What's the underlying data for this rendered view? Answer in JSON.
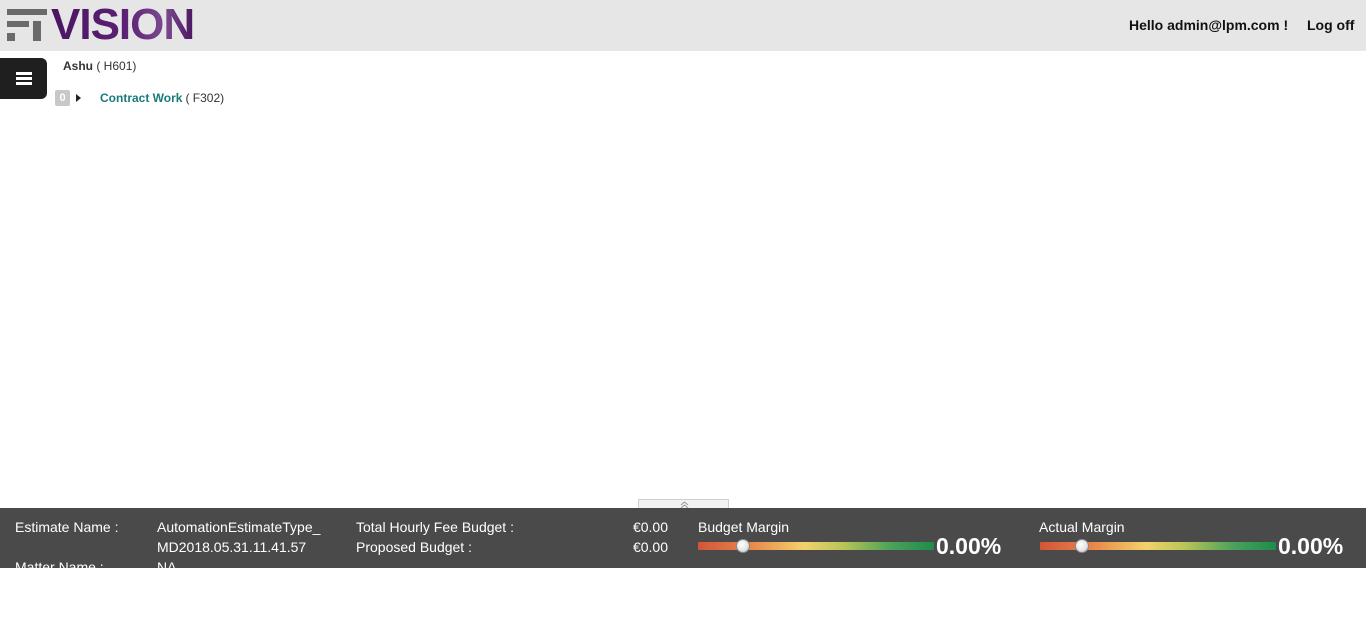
{
  "header": {
    "logo_text": "VISION",
    "greeting": "Hello admin@lpm.com !",
    "logoff_label": "Log off"
  },
  "menu": {
    "icon": "hamburger-icon"
  },
  "tree": {
    "root_name": "Ashu",
    "root_code": "( H601)",
    "items": [
      {
        "badge": "0",
        "icon": "caret-right-icon",
        "label": "Contract Work",
        "code": "( F302)"
      }
    ]
  },
  "collapse_handle": {
    "icon": "double-chevron-up-icon"
  },
  "footer": {
    "estimate_name_label": "Estimate Name :",
    "estimate_name_line1": "AutomationEstimateType_",
    "estimate_name_line2": "MD2018.05.31.11.41.57",
    "matter_name_label": "Matter Name :",
    "matter_name_value": "NA",
    "total_hourly_label": "Total Hourly Fee Budget :",
    "total_hourly_value": "€0.00",
    "proposed_budget_label": "Proposed Budget :",
    "proposed_budget_value": "€0.00",
    "budget_margin": {
      "title": "Budget Margin",
      "value": "0.00%",
      "level": 0.19
    },
    "actual_margin": {
      "title": "Actual Margin",
      "value": "0.00%",
      "level": 0.18
    }
  },
  "colors": {
    "header_bg": "#e6e6e6",
    "brand_purple": "#5a1f74",
    "link_teal": "#1a7a7a",
    "footer_bg": "#4a4a4a"
  }
}
